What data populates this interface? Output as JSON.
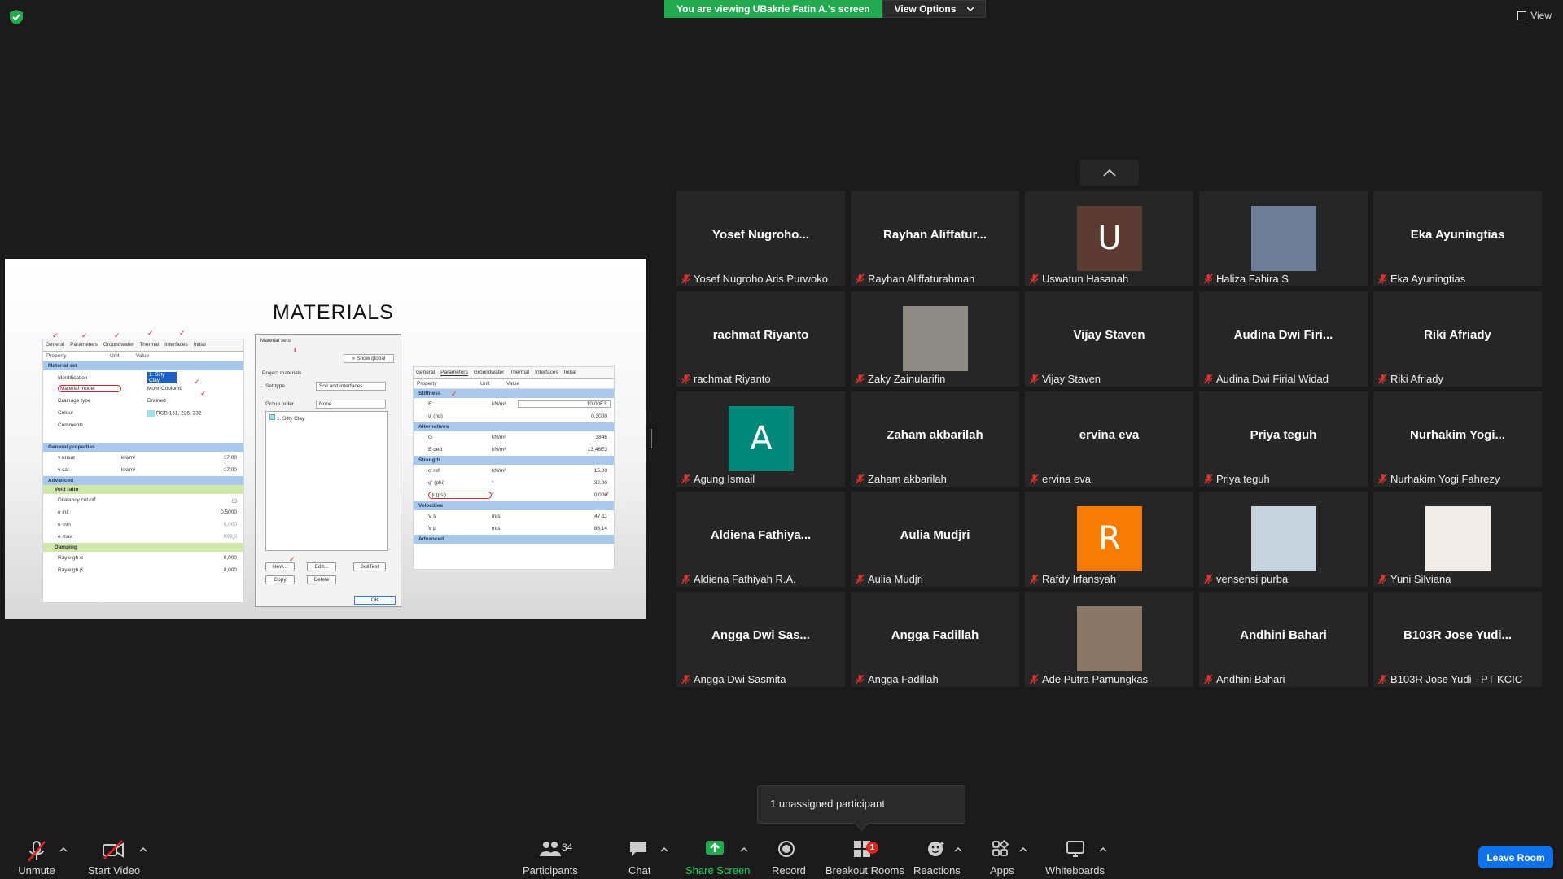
{
  "top": {
    "banner_text": "You are viewing UBakrie Fatin A.'s screen",
    "view_options": "View Options",
    "view_label": "View"
  },
  "share": {
    "title": "MATERIALS",
    "left_panel": {
      "tabs": [
        "General",
        "Parameters",
        "Groundwater",
        "Thermal",
        "Interfaces",
        "Initial"
      ],
      "header": [
        "Property",
        "Unit",
        "Value"
      ],
      "sections": {
        "material_set": "Material set",
        "general_properties": "General properties",
        "advanced": "Advanced",
        "void_ratio": "Void ratio",
        "damping": "Damping"
      },
      "rows": {
        "identification": [
          "Identification",
          "",
          "1. Silty Clay"
        ],
        "material_model": [
          "Material model",
          "",
          "Mohr-Coulomb"
        ],
        "drainage_type": [
          "Drainage type",
          "",
          "Drained"
        ],
        "colour": [
          "Colour",
          "",
          "RGB 161, 226, 232"
        ],
        "comments": [
          "Comments",
          "",
          ""
        ],
        "gamma_unsat": [
          "γ unsat",
          "kN/m³",
          "17,00"
        ],
        "gamma_sat": [
          "γ sat",
          "kN/m³",
          "17,00"
        ],
        "dilatancy": [
          "Dilatancy cut-off",
          "",
          ""
        ],
        "e_init": [
          "e init",
          "",
          "0,5000"
        ],
        "e_min": [
          "e min",
          "",
          "0,000"
        ],
        "e_max": [
          "e max",
          "",
          "999,0"
        ],
        "rayleigh_alpha": [
          "Rayleigh α",
          "",
          "0,000"
        ],
        "rayleigh_beta": [
          "Rayleigh β",
          "",
          "0,000"
        ]
      }
    },
    "middle_panel": {
      "title": "Material sets",
      "show_global": "Show global",
      "project_materials": "Project materials",
      "set_type_label": "Set type",
      "set_type_value": "Soil and interfaces",
      "group_order_label": "Group order",
      "group_order_value": "None",
      "list_item": "1. Silty Clay",
      "buttons": [
        "New...",
        "Edit...",
        "SoilTest",
        "Copy",
        "Delete",
        "OK"
      ]
    },
    "right_panel": {
      "tabs": [
        "General",
        "Parameters",
        "Groundwater",
        "Thermal",
        "Interfaces",
        "Initial"
      ],
      "header": [
        "Property",
        "Unit",
        "Value"
      ],
      "sections": {
        "stiffness": "Stiffness",
        "alternatives": "Alternatives",
        "strength": "Strength",
        "velocities": "Velocities",
        "advanced": "Advanced"
      },
      "rows": {
        "E": [
          "E'",
          "kN/m²",
          "10,00E3"
        ],
        "nu": [
          "ν' (nu)",
          "",
          "0,3000"
        ],
        "G": [
          "G",
          "kN/m²",
          "3846"
        ],
        "Eoed": [
          "E oed",
          "kN/m²",
          "13,46E3"
        ],
        "cref": [
          "c' ref",
          "kN/m²",
          "15,00"
        ],
        "phi": [
          "φ' (phi)",
          "°",
          "32,00"
        ],
        "psi": [
          "ψ (psi)",
          "°",
          "0,000"
        ],
        "Vs": [
          "V s",
          "m/s",
          "47,11"
        ],
        "Vp": [
          "V p",
          "m/s",
          "88,14"
        ]
      }
    }
  },
  "participants": [
    {
      "display": "Yosef  Nugroho...",
      "name": "Yosef Nugroho Aris Purwoko",
      "type": "text"
    },
    {
      "display": "Rayhan  Aliffatur...",
      "name": "Rayhan Aliffaturahman",
      "type": "text"
    },
    {
      "display": "U",
      "name": "Uswatun Hasanah",
      "type": "letter",
      "color": "#5b3a32"
    },
    {
      "display": "",
      "name": "Haliza Fahira S",
      "type": "photo",
      "color": "#6f7f9a"
    },
    {
      "display": "Eka Ayuningtias",
      "name": "Eka Ayuningtias",
      "type": "text"
    },
    {
      "display": "rachmat Riyanto",
      "name": "rachmat Riyanto",
      "type": "text"
    },
    {
      "display": "",
      "name": "Zaky Zainularifin",
      "type": "photo",
      "color": "#8c8b86"
    },
    {
      "display": "Vijay Staven",
      "name": "Vijay Staven",
      "type": "text"
    },
    {
      "display": "Audina  Dwi  Firi...",
      "name": "Audina Dwi Firial Widad",
      "type": "text"
    },
    {
      "display": "Riki Afriady",
      "name": "Riki Afriady",
      "type": "text"
    },
    {
      "display": "A",
      "name": "Agung Ismail",
      "type": "letter",
      "color": "#00897b"
    },
    {
      "display": "Zaham akbarilah",
      "name": "Zaham akbarilah",
      "type": "text"
    },
    {
      "display": "ervina eva",
      "name": "ervina eva",
      "type": "text"
    },
    {
      "display": "Priya teguh",
      "name": "Priya teguh",
      "type": "text"
    },
    {
      "display": "Nurhakim  Yogi...",
      "name": "Nurhakim Yogi Fahrezy",
      "type": "text"
    },
    {
      "display": "Aldiena  Fathiya...",
      "name": "Aldiena Fathiyah R.A.",
      "type": "text"
    },
    {
      "display": "Aulia Mudjri",
      "name": "Aulia Mudjri",
      "type": "text"
    },
    {
      "display": "R",
      "name": "Rafdy Irfansyah",
      "type": "letter",
      "color": "#f57c00"
    },
    {
      "display": "",
      "name": "vensensi purba",
      "type": "photo",
      "color": "#c7d4dd"
    },
    {
      "display": "",
      "name": "Yuni Silviana",
      "type": "photo",
      "color": "#f2ece8"
    },
    {
      "display": "Angga  Dwi  Sas...",
      "name": "Angga Dwi Sasmita",
      "type": "text"
    },
    {
      "display": "Angga Fadillah",
      "name": "Angga Fadillah",
      "type": "text"
    },
    {
      "display": "",
      "name": "Ade Putra Pamungkas",
      "type": "photo",
      "color": "#8a7766"
    },
    {
      "display": "Andhini Bahari",
      "name": "Andhini Bahari",
      "type": "text"
    },
    {
      "display": "B103R  Jose  Yudi...",
      "name": "B103R Jose Yudi - PT KCIC",
      "type": "text"
    }
  ],
  "tooltip": "1 unassigned participant",
  "toolbar": {
    "unmute": "Unmute",
    "start_video": "Start Video",
    "participants": "Participants",
    "participants_count": "34",
    "chat": "Chat",
    "share_screen": "Share Screen",
    "record": "Record",
    "breakout_rooms": "Breakout Rooms",
    "breakout_badge": "1",
    "reactions": "Reactions",
    "apps": "Apps",
    "whiteboards": "Whiteboards",
    "leave": "Leave Room"
  },
  "colors": {
    "green": "#23a94f",
    "leave_blue": "#0e72ed",
    "background": "#1a1a1a",
    "tile": "#262626",
    "muted_red": "#e02424"
  }
}
